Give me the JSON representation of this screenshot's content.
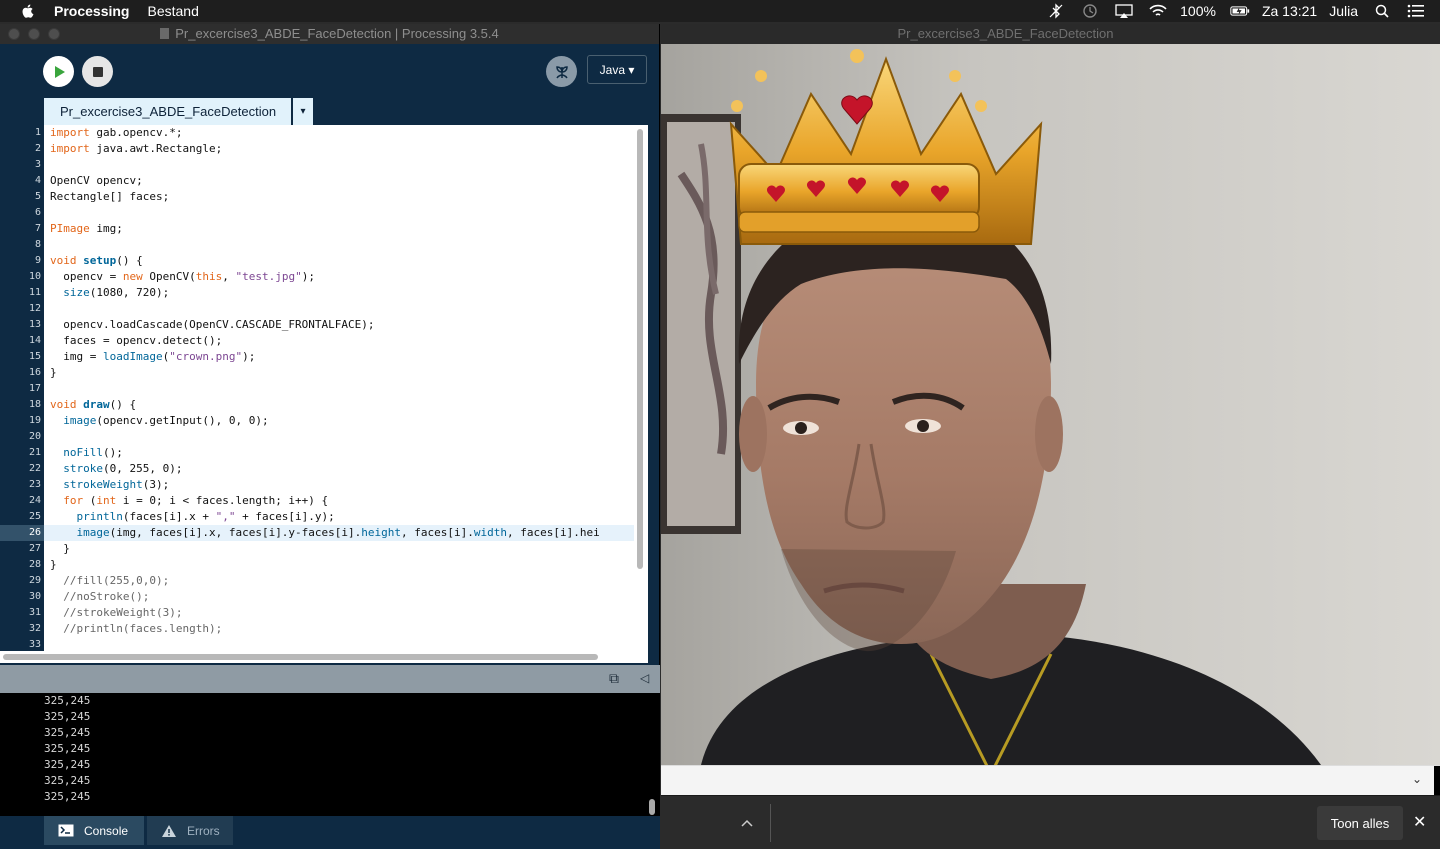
{
  "menubar": {
    "app_name": "Processing",
    "menu_items": [
      "Bestand"
    ],
    "battery": "100%",
    "clock": "Za 13:21",
    "user": "Julia"
  },
  "editor": {
    "window_title": "Pr_excercise3_ABDE_FaceDetection | Processing 3.5.4",
    "mode": "Java ▾",
    "tab_name": "Pr_excercise3_ABDE_FaceDetection",
    "tab_menu": "▾",
    "active_line": 26,
    "code_lines": [
      {
        "n": "1",
        "t": "import gab.opencv.*;"
      },
      {
        "n": "2",
        "t": "import java.awt.Rectangle;"
      },
      {
        "n": "3",
        "t": ""
      },
      {
        "n": "4",
        "t": "OpenCV opencv;"
      },
      {
        "n": "5",
        "t": "Rectangle[] faces;"
      },
      {
        "n": "6",
        "t": ""
      },
      {
        "n": "7",
        "t": "PImage img;"
      },
      {
        "n": "8",
        "t": ""
      },
      {
        "n": "9",
        "t": "void setup() {"
      },
      {
        "n": "10",
        "t": "  opencv = new OpenCV(this, \"test.jpg\");"
      },
      {
        "n": "11",
        "t": "  size(1080, 720);"
      },
      {
        "n": "12",
        "t": ""
      },
      {
        "n": "13",
        "t": "  opencv.loadCascade(OpenCV.CASCADE_FRONTALFACE);"
      },
      {
        "n": "14",
        "t": "  faces = opencv.detect();"
      },
      {
        "n": "15",
        "t": "  img = loadImage(\"crown.png\");"
      },
      {
        "n": "16",
        "t": "}"
      },
      {
        "n": "17",
        "t": ""
      },
      {
        "n": "18",
        "t": "void draw() {"
      },
      {
        "n": "19",
        "t": "  image(opencv.getInput(), 0, 0);"
      },
      {
        "n": "20",
        "t": ""
      },
      {
        "n": "21",
        "t": "  noFill();"
      },
      {
        "n": "22",
        "t": "  stroke(0, 255, 0);"
      },
      {
        "n": "23",
        "t": "  strokeWeight(3);"
      },
      {
        "n": "24",
        "t": "  for (int i = 0; i < faces.length; i++) {"
      },
      {
        "n": "25",
        "t": "    println(faces[i].x + \",\" + faces[i].y);"
      },
      {
        "n": "26",
        "t": "    image(img, faces[i].x, faces[i].y-faces[i].height, faces[i].width, faces[i].hei"
      },
      {
        "n": "27",
        "t": "  }"
      },
      {
        "n": "28",
        "t": "}"
      },
      {
        "n": "29",
        "t": "  //fill(255,0,0);"
      },
      {
        "n": "30",
        "t": "  //noStroke();"
      },
      {
        "n": "31",
        "t": "  //strokeWeight(3);"
      },
      {
        "n": "32",
        "t": "  //println(faces.length);"
      },
      {
        "n": "33",
        "t": ""
      }
    ],
    "console_lines": [
      "325,245",
      "325,245",
      "325,245",
      "325,245",
      "325,245",
      "325,245",
      "325,245"
    ],
    "bottom_tabs": {
      "console": "Console",
      "errors": "Errors"
    }
  },
  "sketch": {
    "window_title": "Pr_excercise3_ABDE_FaceDetection"
  },
  "download_bar": {
    "show_all": "Toon alles"
  },
  "colors": {
    "editor_bg": "#0e2a43",
    "tab_bg": "#e1f2fb",
    "keyword": "#e2661a",
    "function": "#006699",
    "string": "#7d4793",
    "run_green": "#3aa53d"
  }
}
